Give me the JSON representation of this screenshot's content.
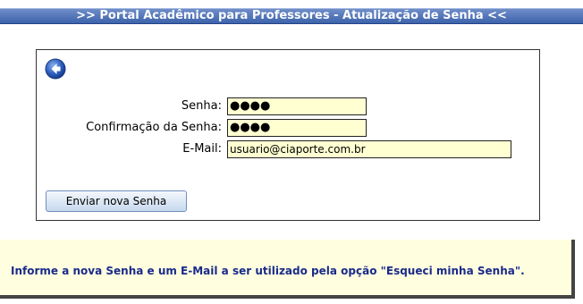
{
  "header": {
    "title": ">> Portal Acadêmico para Professores - Atualização de Senha <<"
  },
  "form": {
    "back_icon": "back-arrow-icon",
    "senha_label": "Senha:",
    "senha_value": "●●●●",
    "confirmacao_label": "Confirmação da Senha:",
    "confirmacao_value": "●●●●",
    "email_label": "E-Mail:",
    "email_value": "usuario@ciaporte.com.br",
    "submit_label": "Enviar nova Senha"
  },
  "info": {
    "message": "Informe a nova Senha e um E-Mail a ser utilizado pela opção \"Esqueci minha Senha\"."
  },
  "colors": {
    "title_bar": "#3d63aa",
    "input_bg": "#ffffd2",
    "info_bg": "#ffffe0",
    "info_text": "#1a2a8a"
  }
}
